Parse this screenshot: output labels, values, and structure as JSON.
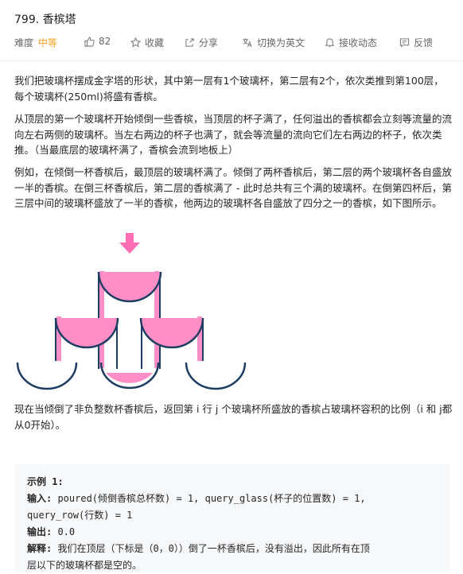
{
  "problem": {
    "title": "799. 香槟塔"
  },
  "toolbar": {
    "difficulty_label": "难度",
    "difficulty_value": "中等",
    "likes_count": "82",
    "favorite_label": "收藏",
    "share_label": "分享",
    "translate_label": "切换为英文",
    "subscribe_label": "接收动态",
    "feedback_label": "反馈"
  },
  "description": {
    "p1": "我们把玻璃杯摆成金字塔的形状，其中第一层有1个玻璃杯，第二层有2个，依次类推到第100层，每个玻璃杯(250ml)将盛有香槟。",
    "p2": "从顶层的第一个玻璃杯开始倾倒一些香槟，当顶层的杯子满了，任何溢出的香槟都会立刻等流量的流向左右两侧的玻璃杯。当左右两边的杯子也满了，就会等流量的流向它们左右两边的杯子，依次类推。（当最底层的玻璃杯满了，香槟会流到地板上）",
    "p3": "例如，在倾倒一杯香槟后，最顶层的玻璃杯满了。倾倒了两杯香槟后，第二层的两个玻璃杯各自盛放一半的香槟。在倒三杯香槟后，第二层的香槟满了 - 此时总共有三个满的玻璃杯。在倒第四杯后，第三层中间的玻璃杯盛放了一半的香槟，他两边的玻璃杯各自盛放了四分之一的香槟，如下图所示。",
    "p4": "现在当倾倒了非负整数杯香槟后，返回第 i 行 j 个玻璃杯所盛放的香槟占玻璃杯容积的比例（i 和 j都从0开始）。"
  },
  "example": {
    "title": "示例 1:",
    "input_label": "输入:",
    "input_line1": " poured(倾倒香槟总杯数) = 1, query_glass(杯子的位置数) = 1,",
    "input_line2": "query_row(行数) = 1",
    "output_label": "输出:",
    "output_value": " 0.0",
    "explain_label": "解释:",
    "explain_line1": " 我们在顶层（下标是（0，0））倒了一杯香槟后，没有溢出，因此所有在顶",
    "explain_line2": "层以下的玻璃杯都是空的。"
  },
  "figure": {
    "pink_color": "#ff8ec6",
    "glass_outline_color": "#1d3d63",
    "arrow_color": "#ff6fb5"
  }
}
